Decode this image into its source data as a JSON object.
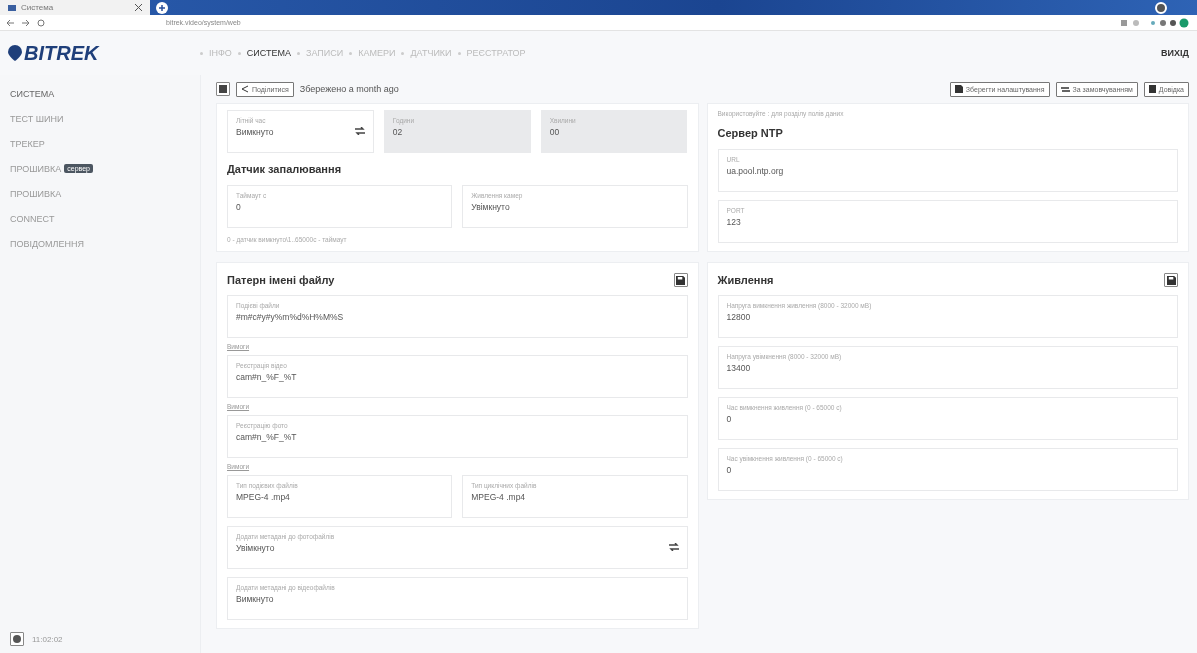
{
  "browser": {
    "tab_title": "Система",
    "address": "bitrek.video/system/web"
  },
  "header": {
    "logo": "BITREK",
    "nav": [
      {
        "label": "ІНФО",
        "selected": false
      },
      {
        "label": "СИСТЕМА",
        "selected": true
      },
      {
        "label": "ЗАПИСИ",
        "selected": false
      },
      {
        "label": "КАМЕРИ",
        "selected": false
      },
      {
        "label": "ДАТЧИКИ",
        "selected": false
      },
      {
        "label": "РЕЄСТРАТОР",
        "selected": false
      }
    ],
    "logout": "ВИХІД"
  },
  "sidebar": {
    "items": [
      {
        "label": "СИСТЕМА"
      },
      {
        "label": "ТЕСТ ШИНИ"
      },
      {
        "label": "ТРЕКЕР"
      },
      {
        "label": "ПРОШИВКА",
        "badge": "сервер"
      },
      {
        "label": "ПРОШИВКА"
      },
      {
        "label": "CONNECT"
      },
      {
        "label": "ПОВІДОМЛЕННЯ"
      }
    ],
    "clock": "11:02:02"
  },
  "toolbar": {
    "share": "Поділитися",
    "saved": "Збережено a month ago",
    "buttons": [
      {
        "kind": "save",
        "label": "Зберегти налаштування"
      },
      {
        "kind": "reset",
        "label": "За замовчуванням"
      },
      {
        "kind": "help",
        "label": "Довідка"
      }
    ]
  },
  "left_cards": [
    {
      "blocks": [
        {
          "kind": "fields",
          "fields": [
            {
              "label": "Літній час",
              "value": "Вимкнуто",
              "kind": "select"
            },
            {
              "label": "Години",
              "value": "02",
              "kind": "readonly"
            },
            {
              "label": "Хвилини",
              "value": "00",
              "kind": "readonly"
            }
          ]
        },
        {
          "kind": "heading",
          "text": "Датчик запалювання"
        },
        {
          "kind": "fields",
          "fields": [
            {
              "label": "Таймаут с",
              "value": "0",
              "kind": "text"
            },
            {
              "label": "Живлення камер",
              "value": "Увімкнуто",
              "kind": "text"
            }
          ]
        },
        {
          "kind": "hint",
          "text": "0 - датчик вимкнуто\\1..65000с - таймаут"
        }
      ]
    },
    {
      "title": "Патерн імені файлу",
      "save_button": true,
      "blocks": [
        {
          "kind": "fields",
          "fields": [
            {
              "label": "Подієві файли",
              "value": "#m#c#y#y%m%d%H%M%S",
              "kind": "text"
            }
          ]
        },
        {
          "kind": "link",
          "text": "Вимоги"
        },
        {
          "kind": "fields",
          "fields": [
            {
              "label": "Реєстрація відео",
              "value": "cam#n_%F_%T",
              "kind": "text"
            }
          ]
        },
        {
          "kind": "link",
          "text": "Вимоги"
        },
        {
          "kind": "fields",
          "fields": [
            {
              "label": "Реєстрацію фото",
              "value": "cam#n_%F_%T",
              "kind": "text"
            }
          ]
        },
        {
          "kind": "link",
          "text": "Вимоги"
        },
        {
          "kind": "fields",
          "fields": [
            {
              "label": "Тип подієвих файлів",
              "value": "MPEG-4 .mp4",
              "kind": "text"
            },
            {
              "label": "Тип циклічних файлів",
              "value": "MPEG-4 .mp4",
              "kind": "text"
            }
          ]
        },
        {
          "kind": "fields",
          "fields": [
            {
              "label": "Додати метадані до фотофайлів",
              "value": "Увімкнуто",
              "kind": "select"
            }
          ]
        },
        {
          "kind": "fields",
          "fields": [
            {
              "label": "Додати метадані до відеофайлів",
              "value": "Вимкнуто",
              "kind": "text"
            }
          ]
        }
      ]
    }
  ],
  "right_cards": [
    {
      "blocks": [
        {
          "kind": "hint",
          "text": "Використовуйте : для розділу полів даних"
        },
        {
          "kind": "heading",
          "text": "Сервер NTP"
        },
        {
          "kind": "fields",
          "fields": [
            {
              "label": "URL",
              "value": "ua.pool.ntp.org",
              "kind": "text"
            }
          ]
        },
        {
          "kind": "fields",
          "fields": [
            {
              "label": "PORT",
              "value": "123",
              "kind": "text"
            }
          ]
        }
      ]
    },
    {
      "title": "Живлення",
      "save_button": true,
      "blocks": [
        {
          "kind": "fields",
          "fields": [
            {
              "label": "Напруга вимкнення живлення (8000 - 32000 мВ)",
              "value": "12800",
              "kind": "text"
            }
          ]
        },
        {
          "kind": "fields",
          "fields": [
            {
              "label": "Напруга увімкнення (8000 - 32000 мВ)",
              "value": "13400",
              "kind": "text"
            }
          ]
        },
        {
          "kind": "fields",
          "fields": [
            {
              "label": "Час вимкнення живлення (0 - 65000 с)",
              "value": "0",
              "kind": "text"
            }
          ]
        },
        {
          "kind": "fields",
          "fields": [
            {
              "label": "Час увімкнення живлення (0 - 65000 с)",
              "value": "0",
              "kind": "text"
            }
          ]
        }
      ]
    }
  ]
}
